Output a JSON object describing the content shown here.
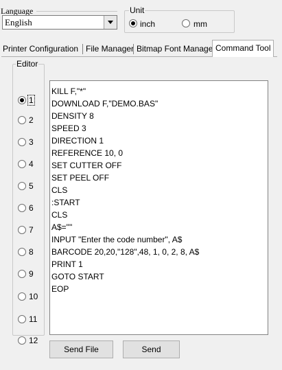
{
  "language": {
    "legend": "Language",
    "selected": "English"
  },
  "unit": {
    "legend": "Unit",
    "options": [
      {
        "label": "inch",
        "checked": true
      },
      {
        "label": "mm",
        "checked": false
      }
    ]
  },
  "tabs": [
    {
      "label": "Printer Configuration",
      "active": false
    },
    {
      "label": "File Manager",
      "active": false
    },
    {
      "label": "Bitmap Font Manager",
      "active": false
    },
    {
      "label": "Command Tool",
      "active": true
    }
  ],
  "editor": {
    "legend": "Editor",
    "selected": "1",
    "options": [
      "1",
      "2",
      "3",
      "4",
      "5",
      "6",
      "7",
      "8",
      "9",
      "10",
      "11",
      "12"
    ]
  },
  "code_lines": [
    "KILL F,\"*\"",
    "DOWNLOAD F,\"DEMO.BAS\"",
    "DENSITY 8",
    "SPEED 3",
    "DIRECTION 1",
    "REFERENCE 10, 0",
    "SET CUTTER OFF",
    "SET PEEL OFF",
    "CLS",
    ":START",
    "CLS",
    "A$=\"\"",
    "INPUT \"Enter the code number\", A$",
    "BARCODE 20,20,\"128\",48, 1, 0, 2, 8, A$",
    "PRINT 1",
    "GOTO START",
    "EOP"
  ],
  "buttons": {
    "send_file": "Send File",
    "send": "Send"
  }
}
